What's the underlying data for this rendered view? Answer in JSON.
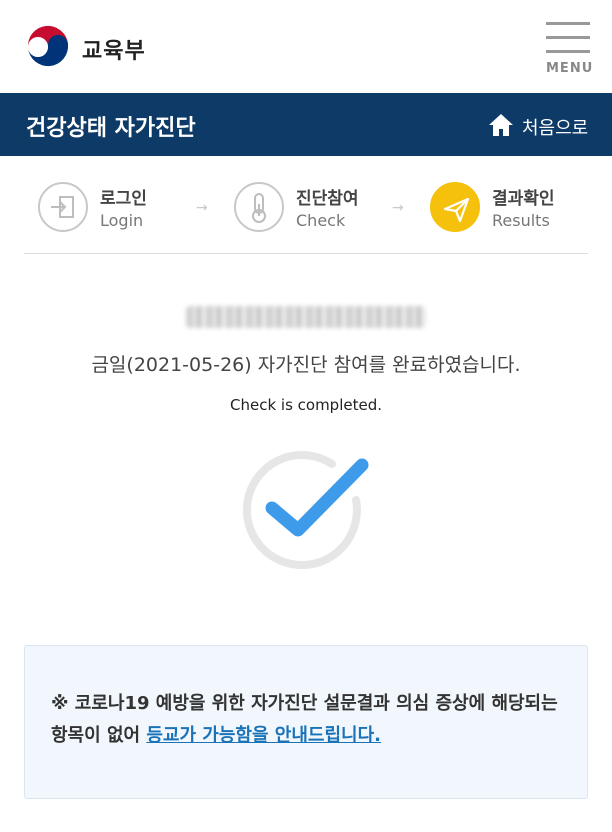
{
  "header": {
    "logo_text": "교육부",
    "menu_label": "MENU"
  },
  "titlebar": {
    "title": "건강상태 자가진단",
    "home_label": "처음으로"
  },
  "steps": [
    {
      "ko": "로그인",
      "en": "Login",
      "icon": "login-icon",
      "active": false
    },
    {
      "ko": "진단참여",
      "en": "Check",
      "icon": "thermometer-icon",
      "active": false
    },
    {
      "ko": "결과확인",
      "en": "Results",
      "icon": "send-icon",
      "active": true
    }
  ],
  "step_arrow": "→",
  "result": {
    "message_ko": "금일(2021-05-26) 자가진단 참여를 완료하였습니다.",
    "message_en": "Check is completed.",
    "check_icon": "check-circle-icon"
  },
  "notice": {
    "text": "※ 코로나19 예방을 위한 자가진단 설문결과 의심 증상에 해당되는 항목이 없어 ",
    "link_text": "등교가 가능함을 안내드립니다."
  },
  "colors": {
    "header_bg": "#0e3a67",
    "active_step": "#f5c10c",
    "check_blue": "#3d9be9",
    "link_blue": "#1a73b8"
  }
}
